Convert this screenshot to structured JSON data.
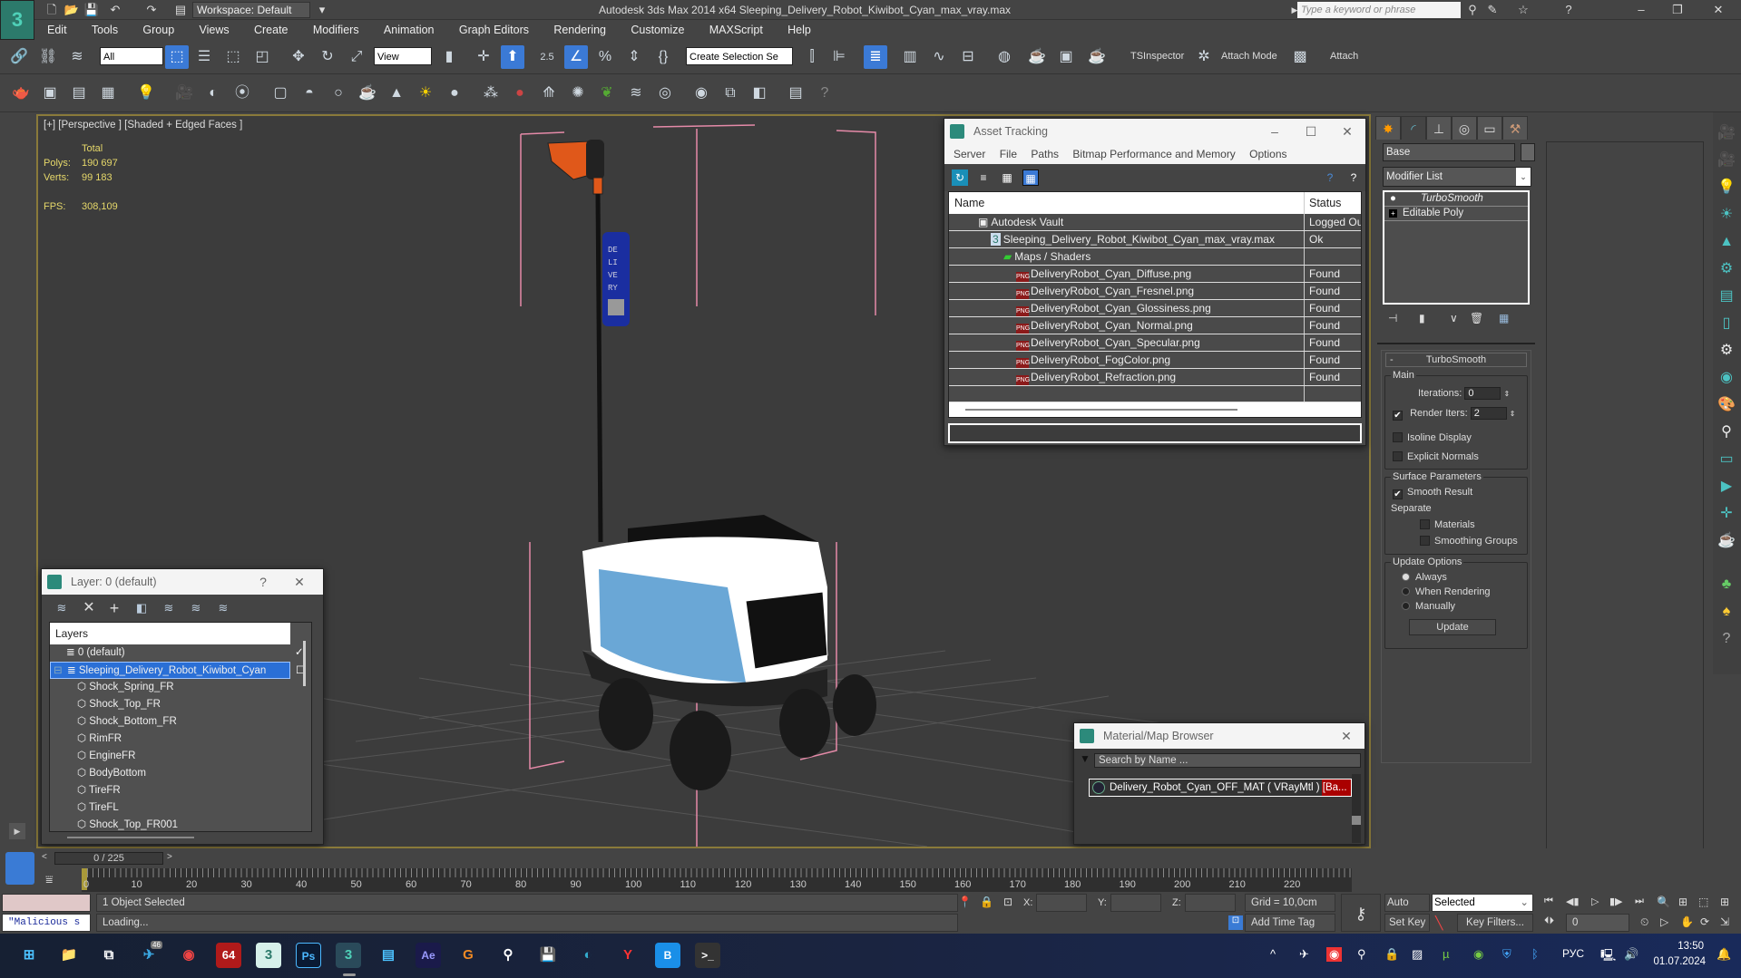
{
  "titlebar": {
    "app_title": "Autodesk 3ds Max  2014 x64    Sleeping_Delivery_Robot_Kiwibot_Cyan_max_vray.max",
    "workspace": "Workspace: Default",
    "search_placeholder": "Type a keyword or phrase",
    "window_controls": [
      "minimize",
      "restore",
      "close"
    ]
  },
  "menu": [
    "Edit",
    "Tools",
    "Group",
    "Views",
    "Create",
    "Modifiers",
    "Animation",
    "Graph Editors",
    "Rendering",
    "Customize",
    "MAXScript",
    "Help"
  ],
  "toolbar": {
    "selection_filter": "All",
    "reference_coord": "View",
    "snap_angle": "2.5",
    "named_selection_placeholder": "Create Selection Se",
    "tsinspector": "TSInspector",
    "attach_mode": "Attach Mode",
    "attach": "Attach"
  },
  "viewport": {
    "label": "[+] [Perspective ] [Shaded + Edged Faces ]",
    "stats": {
      "total_label": "Total",
      "polys_label": "Polys:",
      "polys": "190 697",
      "verts_label": "Verts:",
      "verts": "99 183",
      "fps_label": "FPS:",
      "fps": "308,109"
    }
  },
  "asset_tracking": {
    "title": "Asset Tracking",
    "menu": [
      "Server",
      "File",
      "Paths",
      "Bitmap Performance and Memory",
      "Options"
    ],
    "columns": [
      "Name",
      "Status"
    ],
    "rows": [
      {
        "name": "Autodesk Vault",
        "status": "Logged Out",
        "level": 1,
        "icon": "vault-icon"
      },
      {
        "name": "Sleeping_Delivery_Robot_Kiwibot_Cyan_max_vray.max",
        "status": "Ok",
        "level": 2,
        "icon": "max-file-icon"
      },
      {
        "name": "Maps / Shaders",
        "status": "",
        "level": 3,
        "icon": "maps-icon"
      },
      {
        "name": "DeliveryRobot_Cyan_Diffuse.png",
        "status": "Found",
        "level": 4,
        "icon": "png-icon"
      },
      {
        "name": "DeliveryRobot_Cyan_Fresnel.png",
        "status": "Found",
        "level": 4,
        "icon": "png-icon"
      },
      {
        "name": "DeliveryRobot_Cyan_Glossiness.png",
        "status": "Found",
        "level": 4,
        "icon": "png-icon"
      },
      {
        "name": "DeliveryRobot_Cyan_Normal.png",
        "status": "Found",
        "level": 4,
        "icon": "png-icon"
      },
      {
        "name": "DeliveryRobot_Cyan_Specular.png",
        "status": "Found",
        "level": 4,
        "icon": "png-icon"
      },
      {
        "name": "DeliveryRobot_FogColor.png",
        "status": "Found",
        "level": 4,
        "icon": "png-icon"
      },
      {
        "name": "DeliveryRobot_Refraction.png",
        "status": "Found",
        "level": 4,
        "icon": "png-icon"
      }
    ]
  },
  "command_panel": {
    "object_name": "Base",
    "modifier_list": "Modifier List",
    "stack": [
      "TurboSmooth",
      "Editable Poly"
    ],
    "rollout_title": "TurboSmooth",
    "main_group": "Main",
    "iterations_label": "Iterations:",
    "iterations": "0",
    "render_iters_label": "Render Iters:",
    "render_iters": "2",
    "render_iters_checked": true,
    "isoline_display": "Isoline Display",
    "isoline_checked": false,
    "explicit_normals": "Explicit Normals",
    "explicit_checked": false,
    "surface_group": "Surface Parameters",
    "smooth_result": "Smooth Result",
    "smooth_checked": true,
    "separate_label": "Separate",
    "materials": "Materials",
    "smoothing_groups": "Smoothing Groups",
    "update_group": "Update Options",
    "update_options": [
      "Always",
      "When Rendering",
      "Manually"
    ],
    "update_selected": "Always",
    "update_button": "Update"
  },
  "layer_window": {
    "title": "Layer: 0 (default)",
    "help": "?",
    "header": "Layers",
    "layers": [
      {
        "name": "0 (default)",
        "type": "layer",
        "active": true
      },
      {
        "name": "Sleeping_Delivery_Robot_Kiwibot_Cyan",
        "type": "layer",
        "selected": true
      },
      {
        "name": "Shock_Spring_FR",
        "type": "object"
      },
      {
        "name": "Shock_Top_FR",
        "type": "object"
      },
      {
        "name": "Shock_Bottom_FR",
        "type": "object"
      },
      {
        "name": "RimFR",
        "type": "object"
      },
      {
        "name": "EngineFR",
        "type": "object"
      },
      {
        "name": "BodyBottom",
        "type": "object"
      },
      {
        "name": "TireFR",
        "type": "object"
      },
      {
        "name": "TireFL",
        "type": "object"
      },
      {
        "name": "Shock_Top_FR001",
        "type": "object"
      }
    ]
  },
  "material_browser": {
    "title": "Material/Map Browser",
    "search_placeholder": "Search by Name ...",
    "item": "Delivery_Robot_Cyan_OFF_MAT ( VRayMtl ) [Ba..."
  },
  "timeline": {
    "frame": "0 / 225",
    "ticks": [
      "0",
      "10",
      "20",
      "30",
      "40",
      "50",
      "60",
      "70",
      "80",
      "90",
      "100",
      "110",
      "120",
      "130",
      "140",
      "150",
      "160",
      "170",
      "180",
      "190",
      "200",
      "210",
      "220"
    ]
  },
  "status": {
    "selection": "1 Object Selected",
    "prompt": "Loading...",
    "script_listener": "\"Malicious s",
    "x_label": "X:",
    "y_label": "Y:",
    "z_label": "Z:",
    "grid": "Grid = 10,0cm",
    "add_time_tag": "Add Time Tag",
    "auto_key": "Auto Key",
    "set_key": "Set Key",
    "key_mode": "Selected",
    "key_filters": "Key Filters...",
    "current_frame": "0"
  },
  "taskbar": {
    "apps": [
      "start",
      "file-explorer",
      "task-view",
      "telegram",
      "chrome",
      "aida64",
      "3ds-max-2014",
      "photoshop",
      "3ds-max",
      "notepad",
      "after-effects",
      "g-app",
      "vpn-app",
      "save-app",
      "edge",
      "yandex",
      "b-app",
      "terminal"
    ],
    "telegram_badge": "46",
    "lang": "РУС",
    "time": "13:50",
    "date": "01.07.2024"
  }
}
